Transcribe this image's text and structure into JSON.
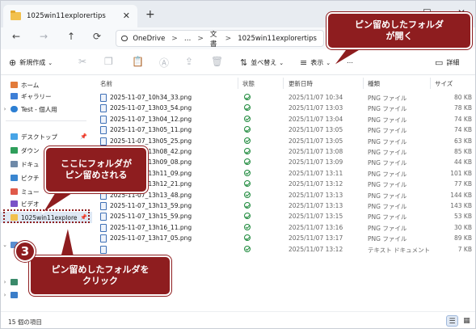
{
  "window": {
    "tab_title": "1025win11explorertips",
    "new_tab": "+",
    "controls": {
      "minimize": "—",
      "maximize": "☐",
      "close": "✕"
    },
    "tab_close": "✕"
  },
  "addressbar": {
    "back": "←",
    "forward": "→",
    "up": "↑",
    "refresh": "⟳",
    "crumbs": [
      "OneDrive",
      "…",
      "文書",
      "1025win11explorertips"
    ],
    "separator": ">"
  },
  "commandbar": {
    "new_label": "新規作成",
    "sort_label": "並べ替え",
    "view_label": "表示",
    "more": "…",
    "details_label": "詳細"
  },
  "navpane": {
    "home": "ホーム",
    "gallery": "ギャラリー",
    "onedrive": "Test - 個人用",
    "desktop": "デスクトップ",
    "downloads": "ダウン",
    "documents": "ドキュ",
    "pictures": "ピクチ",
    "music": "ミュー",
    "videos": "ビデオ",
    "pinned_folder": "1025win11explore"
  },
  "filelist": {
    "columns": {
      "name": "名前",
      "status": "状態",
      "modified": "更新日時",
      "type": "種類",
      "size": "サイズ"
    },
    "rows": [
      {
        "name": "2025-11-07_10h34_33.png",
        "date": "2025/11/07 10:34",
        "type": "PNG ファイル",
        "size": "80 KB"
      },
      {
        "name": "2025-11-07_13h03_54.png",
        "date": "2025/11/07 13:03",
        "type": "PNG ファイル",
        "size": "78 KB"
      },
      {
        "name": "2025-11-07_13h04_12.png",
        "date": "2025/11/07 13:04",
        "type": "PNG ファイル",
        "size": "74 KB"
      },
      {
        "name": "2025-11-07_13h05_11.png",
        "date": "2025/11/07 13:05",
        "type": "PNG ファイル",
        "size": "74 KB"
      },
      {
        "name": "2025-11-07_13h05_25.png",
        "date": "2025/11/07 13:05",
        "type": "PNG ファイル",
        "size": "63 KB"
      },
      {
        "name": "2025-11-07_13h08_42.png",
        "date": "2025/11/07 13:08",
        "type": "PNG ファイル",
        "size": "85 KB"
      },
      {
        "name": "2025-11-07_13h09_08.png",
        "date": "2025/11/07 13:09",
        "type": "PNG ファイル",
        "size": "44 KB"
      },
      {
        "name": "2025-11-07_13h11_09.png",
        "date": "2025/11/07 13:11",
        "type": "PNG ファイル",
        "size": "101 KB"
      },
      {
        "name": "2025-11-07_13h12_21.png",
        "date": "2025/11/07 13:12",
        "type": "PNG ファイル",
        "size": "77 KB"
      },
      {
        "name": "2025-11-07_13h13_48.png",
        "date": "2025/11/07 13:13",
        "type": "PNG ファイル",
        "size": "144 KB"
      },
      {
        "name": "2025-11-07_13h13_59.png",
        "date": "2025/11/07 13:13",
        "type": "PNG ファイル",
        "size": "143 KB"
      },
      {
        "name": "2025-11-07_13h15_59.png",
        "date": "2025/11/07 13:15",
        "type": "PNG ファイル",
        "size": "53 KB"
      },
      {
        "name": "2025-11-07_13h16_11.png",
        "date": "2025/11/07 13:16",
        "type": "PNG ファイル",
        "size": "30 KB"
      },
      {
        "name": "2025-11-07_13h17_05.png",
        "date": "2025/11/07 13:17",
        "type": "PNG ファイル",
        "size": "89 KB"
      },
      {
        "name": "",
        "date": "2025/11/07 13:12",
        "type": "テキスト ドキュメント",
        "size": "7 KB"
      }
    ]
  },
  "statusbar": {
    "count": "15 個の項目"
  },
  "annotations": {
    "top_callout_line1": "ピン留めしたフォルダ",
    "top_callout_line2": "が開く",
    "mid_callout_line1": "ここにフォルダが",
    "mid_callout_line2": "ピン留めされる",
    "step_number": "3",
    "bottom_callout_line1": "ピン留めしたフォルダを",
    "bottom_callout_line2": "クリック"
  },
  "colors": {
    "annotation": "#8e1d1f",
    "selection": "#dfe8f4",
    "status_ok": "#1e8a3c",
    "folder": "#f2c14e"
  }
}
